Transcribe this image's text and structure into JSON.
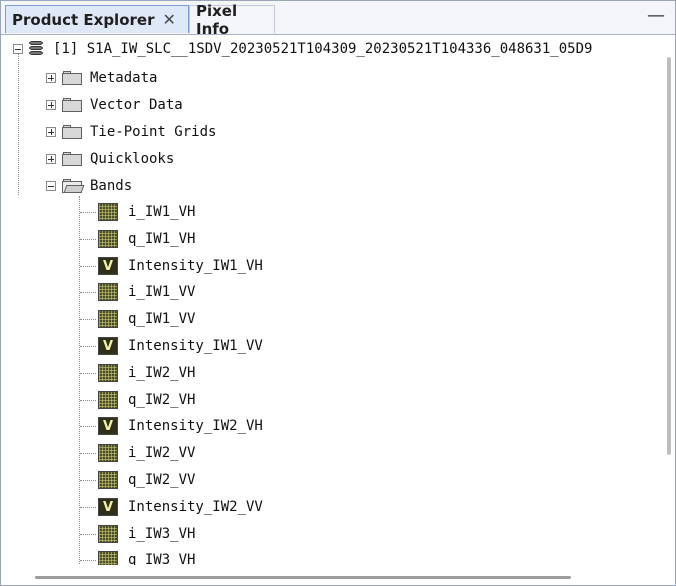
{
  "tabs": [
    {
      "label": "Product Explorer",
      "close": "✕"
    },
    {
      "label": "Pixel Info"
    }
  ],
  "minimize_glyph": "—",
  "product": {
    "label": "[1] S1A_IW_SLC__1SDV_20230521T104309_20230521T104336_048631_05D9"
  },
  "groups": [
    {
      "label": "Metadata"
    },
    {
      "label": "Vector Data"
    },
    {
      "label": "Tie-Point Grids"
    },
    {
      "label": "Quicklooks"
    },
    {
      "label": "Bands"
    }
  ],
  "bands": [
    {
      "label": "i_IW1_VH",
      "virtual": false
    },
    {
      "label": "q_IW1_VH",
      "virtual": false
    },
    {
      "label": "Intensity_IW1_VH",
      "virtual": true
    },
    {
      "label": "i_IW1_VV",
      "virtual": false
    },
    {
      "label": "q_IW1_VV",
      "virtual": false
    },
    {
      "label": "Intensity_IW1_VV",
      "virtual": true
    },
    {
      "label": "i_IW2_VH",
      "virtual": false
    },
    {
      "label": "q_IW2_VH",
      "virtual": false
    },
    {
      "label": "Intensity_IW2_VH",
      "virtual": true
    },
    {
      "label": "i_IW2_VV",
      "virtual": false
    },
    {
      "label": "q_IW2_VV",
      "virtual": false
    },
    {
      "label": "Intensity_IW2_VV",
      "virtual": true
    },
    {
      "label": "i_IW3_VH",
      "virtual": false
    },
    {
      "label": "q_IW3_VH",
      "virtual": false
    }
  ],
  "virtual_glyph": "V"
}
